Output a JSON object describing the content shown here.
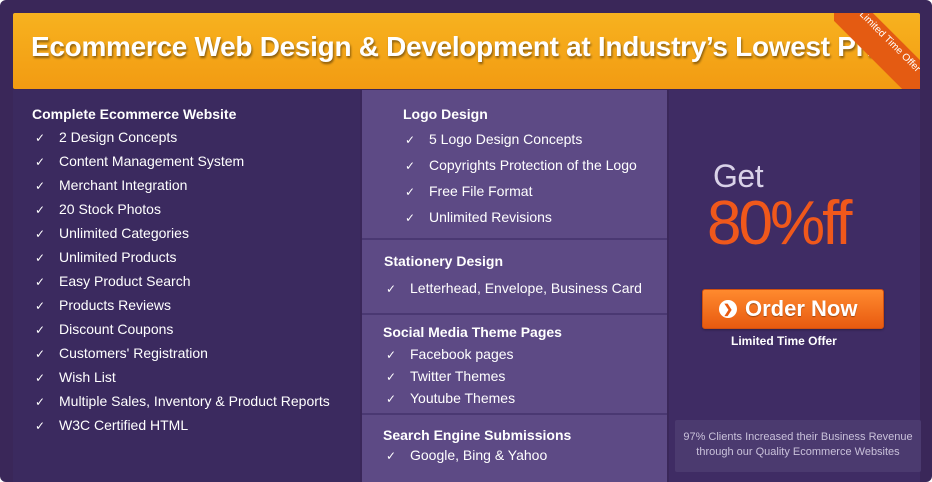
{
  "header": {
    "title": "Ecommerce Web Design & Development at Industry’s Lowest Price",
    "ribbon": "Limited Time Offer"
  },
  "left": {
    "heading": "Complete Ecommerce Website",
    "items": [
      "2 Design Concepts",
      "Content Management System",
      "Merchant Integration",
      "20 Stock Photos",
      "Unlimited Categories",
      "Unlimited Products",
      "Easy Product Search",
      "Products Reviews",
      "Discount Coupons",
      "Customers' Registration",
      "Wish List",
      "Multiple Sales, Inventory & Product Reports",
      "W3C Certified HTML"
    ]
  },
  "middle": {
    "logo": {
      "heading": "Logo Design",
      "items": [
        "5 Logo Design Concepts",
        "Copyrights Protection of the Logo",
        "Free File Format",
        "Unlimited Revisions"
      ]
    },
    "stationery": {
      "heading": "Stationery Design",
      "items": [
        "Letterhead, Envelope, Business Card"
      ]
    },
    "social": {
      "heading": "Social Media Theme Pages",
      "items": [
        "Facebook pages",
        "Twitter Themes",
        "Youtube Themes"
      ]
    },
    "search": {
      "heading": "Search Engine Submissions",
      "items": [
        "Google, Bing & Yahoo"
      ]
    }
  },
  "right": {
    "get": "Get",
    "discount": "80%ff",
    "order_button": "Order Now",
    "limited": "Limited Time Offer",
    "stats_line1": "97% Clients Increased their Business Revenue",
    "stats_line2": "through our Quality Ecommerce Websites"
  },
  "icons": {
    "check": "check-icon",
    "order": "arrow-right-circle-icon"
  },
  "colors": {
    "banner": "#f7a81a",
    "accent": "#f0581b",
    "background": "#3a2759",
    "middle_column": "#5d4a85"
  }
}
